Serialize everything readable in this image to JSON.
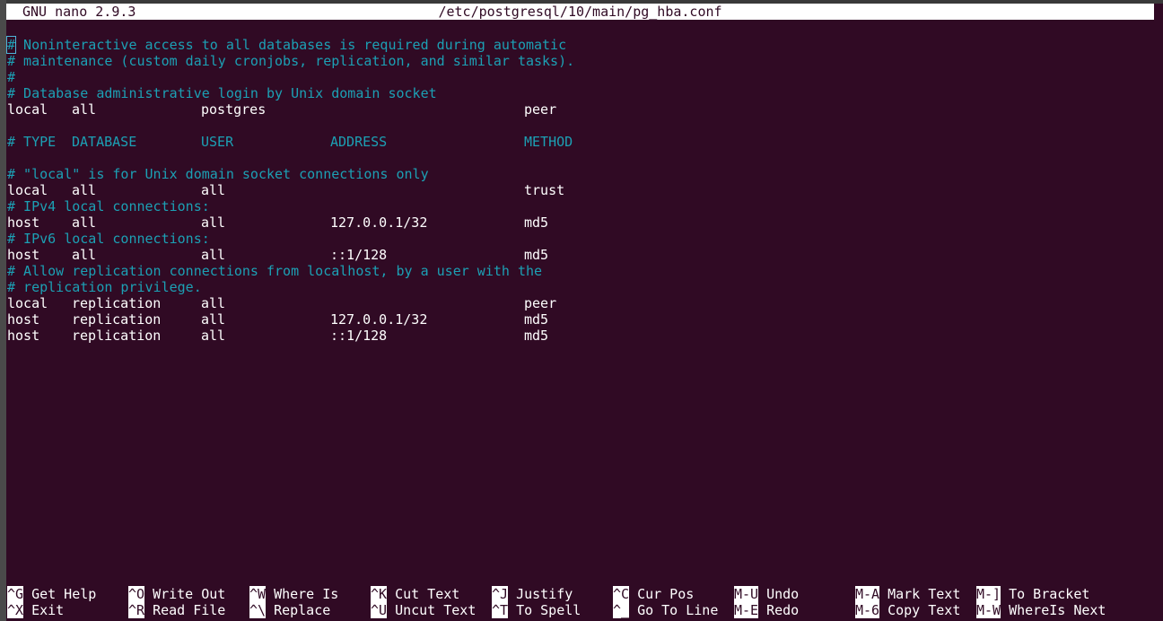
{
  "titlebar": {
    "app": "GNU nano 2.9.3",
    "file": "/etc/postgresql/10/main/pg_hba.conf"
  },
  "editor": {
    "lines": [
      {
        "type": "comment",
        "text": "# Noninteractive access to all databases is required during automatic",
        "cursor_char": "#",
        "rest": " Noninteractive access to all databases is required during automatic"
      },
      {
        "type": "comment",
        "text": "# maintenance (custom daily cronjobs, replication, and similar tasks)."
      },
      {
        "type": "comment",
        "text": "#"
      },
      {
        "type": "comment",
        "text": "# Database administrative login by Unix domain socket"
      },
      {
        "type": "entry",
        "cols": [
          "local",
          "all",
          "postgres",
          "",
          "peer"
        ]
      },
      {
        "type": "blank",
        "text": ""
      },
      {
        "type": "header",
        "cols": [
          "# TYPE",
          "DATABASE",
          "USER",
          "ADDRESS",
          "METHOD"
        ]
      },
      {
        "type": "blank",
        "text": ""
      },
      {
        "type": "comment",
        "text": "# \"local\" is for Unix domain socket connections only"
      },
      {
        "type": "entry",
        "cols": [
          "local",
          "all",
          "all",
          "",
          "trust"
        ]
      },
      {
        "type": "comment",
        "text": "# IPv4 local connections:"
      },
      {
        "type": "entry",
        "cols": [
          "host",
          "all",
          "all",
          "127.0.0.1/32",
          "md5"
        ]
      },
      {
        "type": "comment",
        "text": "# IPv6 local connections:"
      },
      {
        "type": "entry",
        "cols": [
          "host",
          "all",
          "all",
          "::1/128",
          "md5"
        ]
      },
      {
        "type": "comment",
        "text": "# Allow replication connections from localhost, by a user with the"
      },
      {
        "type": "comment",
        "text": "# replication privilege."
      },
      {
        "type": "entry",
        "cols": [
          "local",
          "replication",
          "all",
          "",
          "peer"
        ]
      },
      {
        "type": "entry",
        "cols": [
          "host",
          "replication",
          "all",
          "127.0.0.1/32",
          "md5"
        ]
      },
      {
        "type": "entry",
        "cols": [
          "host",
          "replication",
          "all",
          "::1/128",
          "md5"
        ]
      }
    ]
  },
  "shortcuts": [
    [
      {
        "key": "^G",
        "label": "Get Help"
      },
      {
        "key": "^X",
        "label": "Exit"
      }
    ],
    [
      {
        "key": "^O",
        "label": "Write Out"
      },
      {
        "key": "^R",
        "label": "Read File"
      }
    ],
    [
      {
        "key": "^W",
        "label": "Where Is"
      },
      {
        "key": "^\\",
        "label": "Replace"
      }
    ],
    [
      {
        "key": "^K",
        "label": "Cut Text"
      },
      {
        "key": "^U",
        "label": "Uncut Text"
      }
    ],
    [
      {
        "key": "^J",
        "label": "Justify"
      },
      {
        "key": "^T",
        "label": "To Spell"
      }
    ],
    [
      {
        "key": "^C",
        "label": "Cur Pos"
      },
      {
        "key": "^_",
        "label": "Go To Line"
      }
    ],
    [
      {
        "key": "M-U",
        "label": "Undo"
      },
      {
        "key": "M-E",
        "label": "Redo"
      }
    ],
    [
      {
        "key": "M-A",
        "label": "Mark Text"
      },
      {
        "key": "M-6",
        "label": "Copy Text"
      }
    ],
    [
      {
        "key": "M-]",
        "label": "To Bracket"
      },
      {
        "key": "M-W",
        "label": "WhereIs Next"
      }
    ]
  ],
  "colors": {
    "background": "#300a24",
    "comment": "#1ca0b4",
    "text": "#ffffff"
  }
}
